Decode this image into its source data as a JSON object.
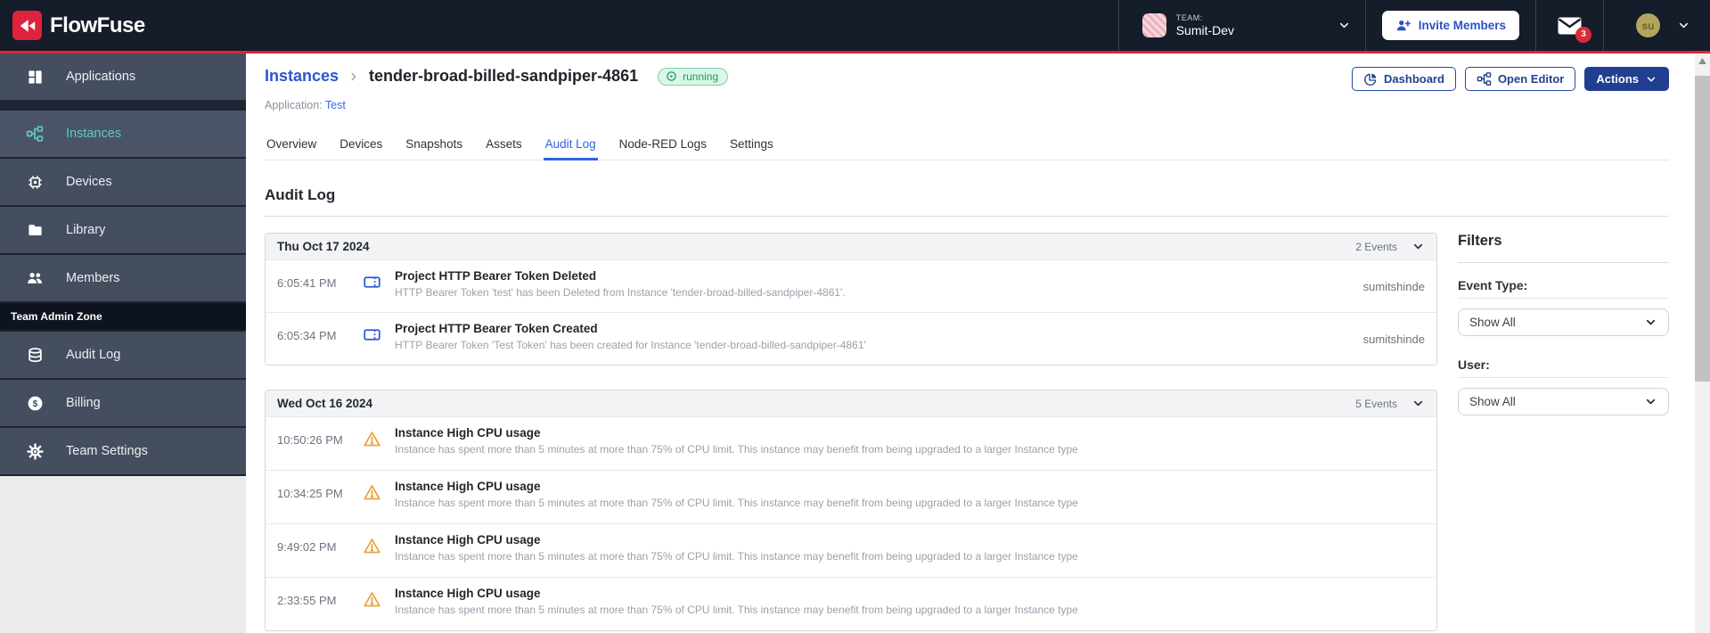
{
  "navbar": {
    "brand": "FlowFuse",
    "team_label": "TEAM:",
    "team_name": "Sumit-Dev",
    "invite_button": "Invite Members",
    "notification_count": "3",
    "user_initials": "su"
  },
  "sidebar": {
    "items": [
      {
        "label": "Applications"
      },
      {
        "label": "Instances"
      },
      {
        "label": "Devices"
      },
      {
        "label": "Library"
      },
      {
        "label": "Members"
      }
    ],
    "admin_zone_label": "Team Admin Zone",
    "admin_items": [
      {
        "label": "Audit Log"
      },
      {
        "label": "Billing"
      },
      {
        "label": "Team Settings"
      }
    ]
  },
  "header": {
    "breadcrumb_parent": "Instances",
    "instance_name": "tender-broad-billed-sandpiper-4861",
    "status_badge": "running",
    "application_label": "Application:",
    "application_name": "Test",
    "dashboard_button": "Dashboard",
    "open_editor_button": "Open Editor",
    "actions_button": "Actions"
  },
  "tabs": [
    "Overview",
    "Devices",
    "Snapshots",
    "Assets",
    "Audit Log",
    "Node-RED Logs",
    "Settings"
  ],
  "main": {
    "title": "Audit Log"
  },
  "audit": {
    "groups": [
      {
        "date": "Thu Oct 17 2024",
        "count": "2 Events",
        "events": [
          {
            "time": "6:05:41 PM",
            "title": "Project HTTP Bearer Token Deleted",
            "description": "HTTP Bearer Token 'test' has been Deleted from Instance 'tender-broad-billed-sandpiper-4861'.",
            "user": "sumitshinde"
          },
          {
            "time": "6:05:34 PM",
            "title": "Project HTTP Bearer Token Created",
            "description": "HTTP Bearer Token 'Test Token' has been created for Instance 'tender-broad-billed-sandpiper-4861'",
            "user": "sumitshinde"
          }
        ]
      },
      {
        "date": "Wed Oct 16 2024",
        "count": "5 Events",
        "events": [
          {
            "time": "10:50:26 PM",
            "title": "Instance High CPU usage",
            "description": "Instance has spent more than 5 minutes at more than 75% of CPU limit. This instance may benefit from being upgraded to a larger Instance type"
          },
          {
            "time": "10:34:25 PM",
            "title": "Instance High CPU usage",
            "description": "Instance has spent more than 5 minutes at more than 75% of CPU limit. This instance may benefit from being upgraded to a larger Instance type"
          },
          {
            "time": "9:49:02 PM",
            "title": "Instance High CPU usage",
            "description": "Instance has spent more than 5 minutes at more than 75% of CPU limit. This instance may benefit from being upgraded to a larger Instance type"
          },
          {
            "time": "2:33:55 PM",
            "title": "Instance High CPU usage",
            "description": "Instance has spent more than 5 minutes at more than 75% of CPU limit. This instance may benefit from being upgraded to a larger Instance type"
          }
        ]
      }
    ]
  },
  "filters": {
    "title": "Filters",
    "event_type_label": "Event Type:",
    "event_type_value": "Show All",
    "user_label": "User:",
    "user_value": "Show All"
  },
  "colors": {
    "brand_red": "#df233d",
    "teal_accent": "#5ecdbd",
    "link_blue": "#2d56d0",
    "primary_navy": "#213f90",
    "status_green": "#1e9e5d",
    "warning_amber": "#eca23b"
  }
}
